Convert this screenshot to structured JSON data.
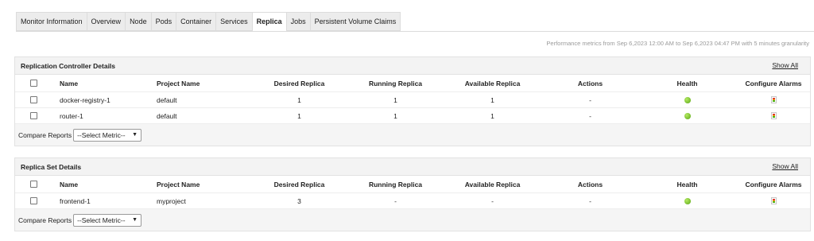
{
  "tabs": [
    {
      "label": "Monitor Information"
    },
    {
      "label": "Overview"
    },
    {
      "label": "Node"
    },
    {
      "label": "Pods"
    },
    {
      "label": "Container"
    },
    {
      "label": "Services"
    },
    {
      "label": "Replica",
      "active": true
    },
    {
      "label": "Jobs"
    },
    {
      "label": "Persistent Volume Claims"
    }
  ],
  "perf_text": "Performance metrics from Sep 6,2023 12:00 AM to Sep 6,2023 04:47 PM with 5 minutes granularity",
  "columns": {
    "name": "Name",
    "project": "Project Name",
    "desired": "Desired Replica",
    "running": "Running Replica",
    "available": "Available Replica",
    "actions": "Actions",
    "health": "Health",
    "alarms": "Configure Alarms"
  },
  "rc": {
    "title": "Replication Controller Details",
    "show_all": "Show All",
    "rows": [
      {
        "name": "docker-registry-1",
        "project": "default",
        "desired": "1",
        "running": "1",
        "available": "1",
        "actions": "-",
        "health": "green"
      },
      {
        "name": "router-1",
        "project": "default",
        "desired": "1",
        "running": "1",
        "available": "1",
        "actions": "-",
        "health": "green"
      }
    ],
    "compare_label": "Compare Reports",
    "select_value": "--Select Metric--"
  },
  "rs": {
    "title": "Replica Set Details",
    "show_all": "Show All",
    "rows": [
      {
        "name": "frontend-1",
        "project": "myproject",
        "desired": "3",
        "running": "-",
        "available": "-",
        "actions": "-",
        "health": "green"
      }
    ],
    "compare_label": "Compare Reports",
    "select_value": "--Select Metric--"
  },
  "colors": {
    "health_green": "#5aa615",
    "tab_bg": "#ececec",
    "header_bg": "#f3f3f3"
  },
  "icons": {
    "health": "health-dot-icon",
    "alarm": "traffic-light-icon",
    "select": "chevron-down-icon"
  }
}
